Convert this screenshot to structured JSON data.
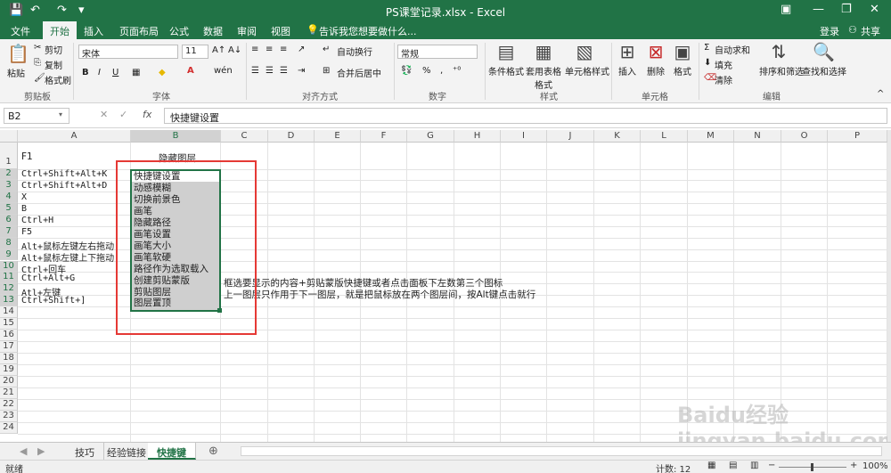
{
  "window": {
    "title": "PS课堂记录.xlsx - Excel",
    "minimize": "—",
    "maximize": "❐",
    "close": "✕"
  },
  "quick_access": {
    "save": "💾",
    "undo": "↶",
    "redo": "↷",
    "customize": "▾"
  },
  "tabs": [
    "文件",
    "开始",
    "插入",
    "页面布局",
    "公式",
    "数据",
    "审阅",
    "视图"
  ],
  "active_tab": "开始",
  "tell_me": "告诉我您想要做什么...",
  "account": {
    "login": "登录",
    "share": "共享"
  },
  "ribbon": {
    "clipboard": {
      "label": "剪贴板",
      "paste": "粘贴",
      "cut": "剪切",
      "copy": "复制",
      "format_painter": "格式刷"
    },
    "font": {
      "label": "字体",
      "name": "宋体",
      "size": "11",
      "bold": "B",
      "italic": "I",
      "underline": "U"
    },
    "alignment": {
      "label": "对齐方式",
      "wrap": "自动换行",
      "merge": "合并后居中"
    },
    "number": {
      "label": "数字",
      "format": "常规",
      "percent": "%",
      "comma": ","
    },
    "styles": {
      "label": "样式",
      "conditional": "条件格式",
      "table": "套用表格格式",
      "cell_styles": "单元格样式"
    },
    "cells": {
      "label": "单元格",
      "insert": "插入",
      "delete": "删除",
      "format": "格式"
    },
    "editing": {
      "label": "编辑",
      "autosum": "自动求和",
      "fill": "填充",
      "clear": "清除",
      "sort": "排序和筛选",
      "find": "查找和选择"
    }
  },
  "formula_bar": {
    "name_box": "B2",
    "fx": "fx",
    "content": "快捷键设置"
  },
  "columns": [
    "A",
    "B",
    "C",
    "D",
    "E",
    "F",
    "G",
    "H",
    "I",
    "J",
    "K",
    "L",
    "M",
    "N",
    "O",
    "P"
  ],
  "rows": [
    "1",
    "2",
    "3",
    "4",
    "5",
    "6",
    "7",
    "8",
    "9",
    "10",
    "11",
    "12",
    "13",
    "14",
    "15",
    "16",
    "17",
    "18",
    "19",
    "20",
    "21",
    "22",
    "23",
    "24"
  ],
  "cells": {
    "A_header": "F1",
    "B_header": "隐藏图层",
    "colA": [
      "Ctrl+Shift+Alt+K",
      "Ctrl+Shift+Alt+D",
      "X",
      "B",
      "Ctrl+H",
      "F5",
      "Alt+鼠标左键左右拖动",
      "Alt+鼠标左键上下拖动",
      "Ctrl+回车",
      "Ctrl+Alt+G",
      "Atl+左键",
      "Ctrl+Shift+]"
    ],
    "colB": [
      "快捷键设置",
      "动感模糊",
      "切换前景色",
      "画笔",
      "隐藏路径",
      "画笔设置",
      "画笔大小",
      "画笔软硬",
      "路径作为选取载入",
      "创建剪贴蒙版",
      "剪贴图层",
      "图层置顶"
    ],
    "C11": "框选要显示的内容+剪贴蒙版快捷键或者点击面板下左数第三个图标",
    "C12": "上一图层只作用于下一图层，就是把鼠标放在两个图层间，按Alt键点击就行"
  },
  "sheets": [
    "技巧",
    "经验链接",
    "快捷键"
  ],
  "active_sheet": "快捷键",
  "status": {
    "ready": "就绪",
    "count": "计数: 12",
    "zoom": "100%"
  },
  "watermark": "Baidu经验 jingyan.baidu.com",
  "colors": {
    "excel_green": "#217346",
    "annotation_red": "#e53935"
  }
}
